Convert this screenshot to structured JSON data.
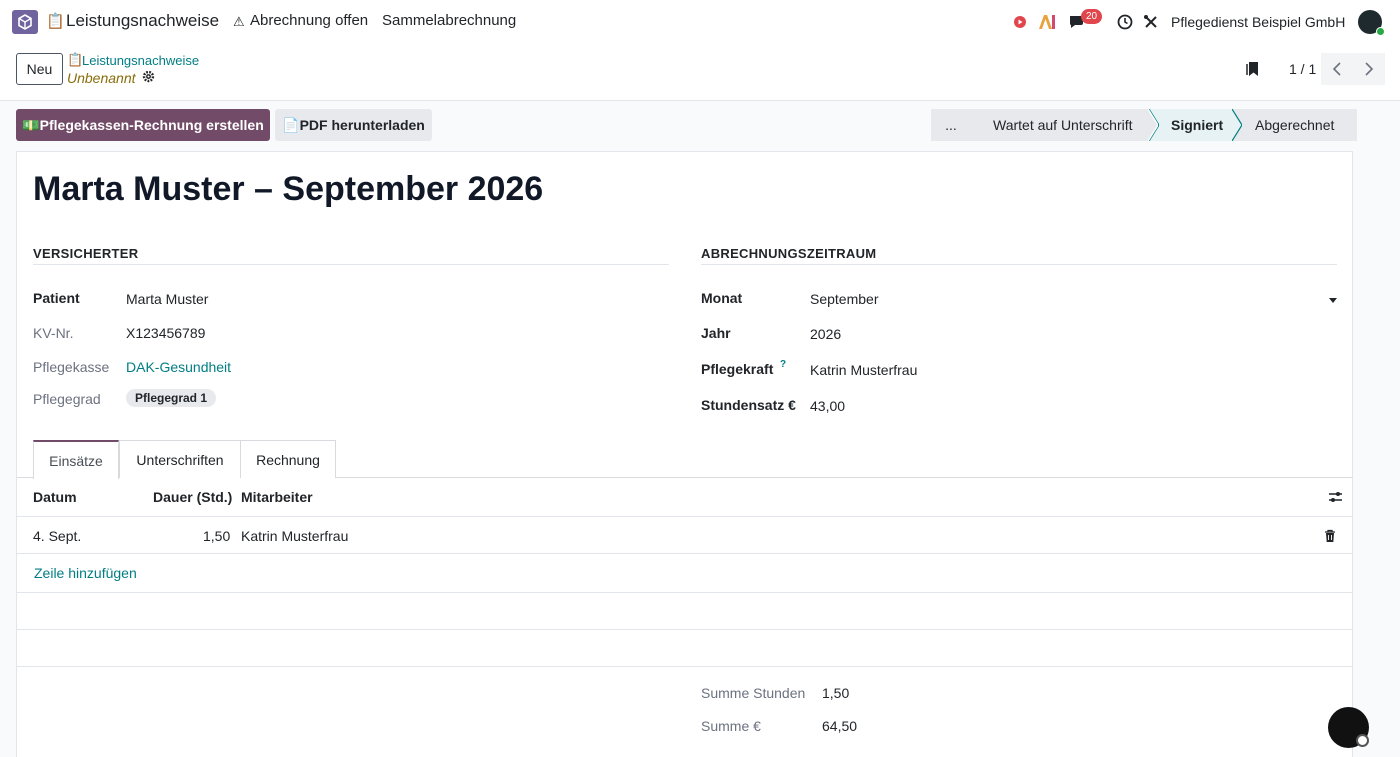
{
  "navbar": {
    "app_title": "Leistungsnachweise",
    "menu_open_billing": "Abrechnung offen",
    "menu_collective": "Sammelabrechnung",
    "message_count": "20",
    "company": "Pflegedienst Beispiel GmbH"
  },
  "control": {
    "new_label": "Neu",
    "breadcrumb_parent": "Leistungsnachweise",
    "breadcrumb_current": "Unbenannt",
    "pager": "1 / 1"
  },
  "actions": {
    "primary": "Pflegekassen-Rechnung erstellen",
    "secondary": "PDF herunterladen"
  },
  "status": {
    "more": "...",
    "stages": [
      "Wartet auf Unterschrift",
      "Signiert",
      "Abgerechnet"
    ],
    "active": "Signiert"
  },
  "record": {
    "title": "Marta Muster – September 2026",
    "insured": {
      "heading": "VERSICHERTER",
      "patient_label": "Patient",
      "patient": "Marta Muster",
      "kv_label": "KV-Nr.",
      "kv": "X123456789",
      "kasse_label": "Pflegekasse",
      "kasse": "DAK-Gesundheit",
      "grad_label": "Pflegegrad",
      "grad": "Pflegegrad 1"
    },
    "period": {
      "heading": "ABRECHNUNGSZEITRAUM",
      "month_label": "Monat",
      "month": "September",
      "year_label": "Jahr",
      "year": "2026",
      "nurse_label": "Pflegekraft",
      "nurse_help": "?",
      "nurse": "Katrin Musterfrau",
      "rate_label": "Stundensatz €",
      "rate": "43,00"
    }
  },
  "tabs": [
    "Einsätze",
    "Unterschriften",
    "Rechnung"
  ],
  "table": {
    "columns": [
      "Datum",
      "Dauer (Std.)",
      "Mitarbeiter"
    ],
    "rows": [
      {
        "date": "4. Sept.",
        "duration": "1,50",
        "employee": "Katrin Musterfrau"
      }
    ],
    "add_line": "Zeile hinzufügen"
  },
  "totals": {
    "hours_label": "Summe Stunden",
    "hours": "1,50",
    "sum_label": "Summe €",
    "sum": "64,50"
  },
  "colors": {
    "brand": "#714b67",
    "link": "#017e84"
  }
}
